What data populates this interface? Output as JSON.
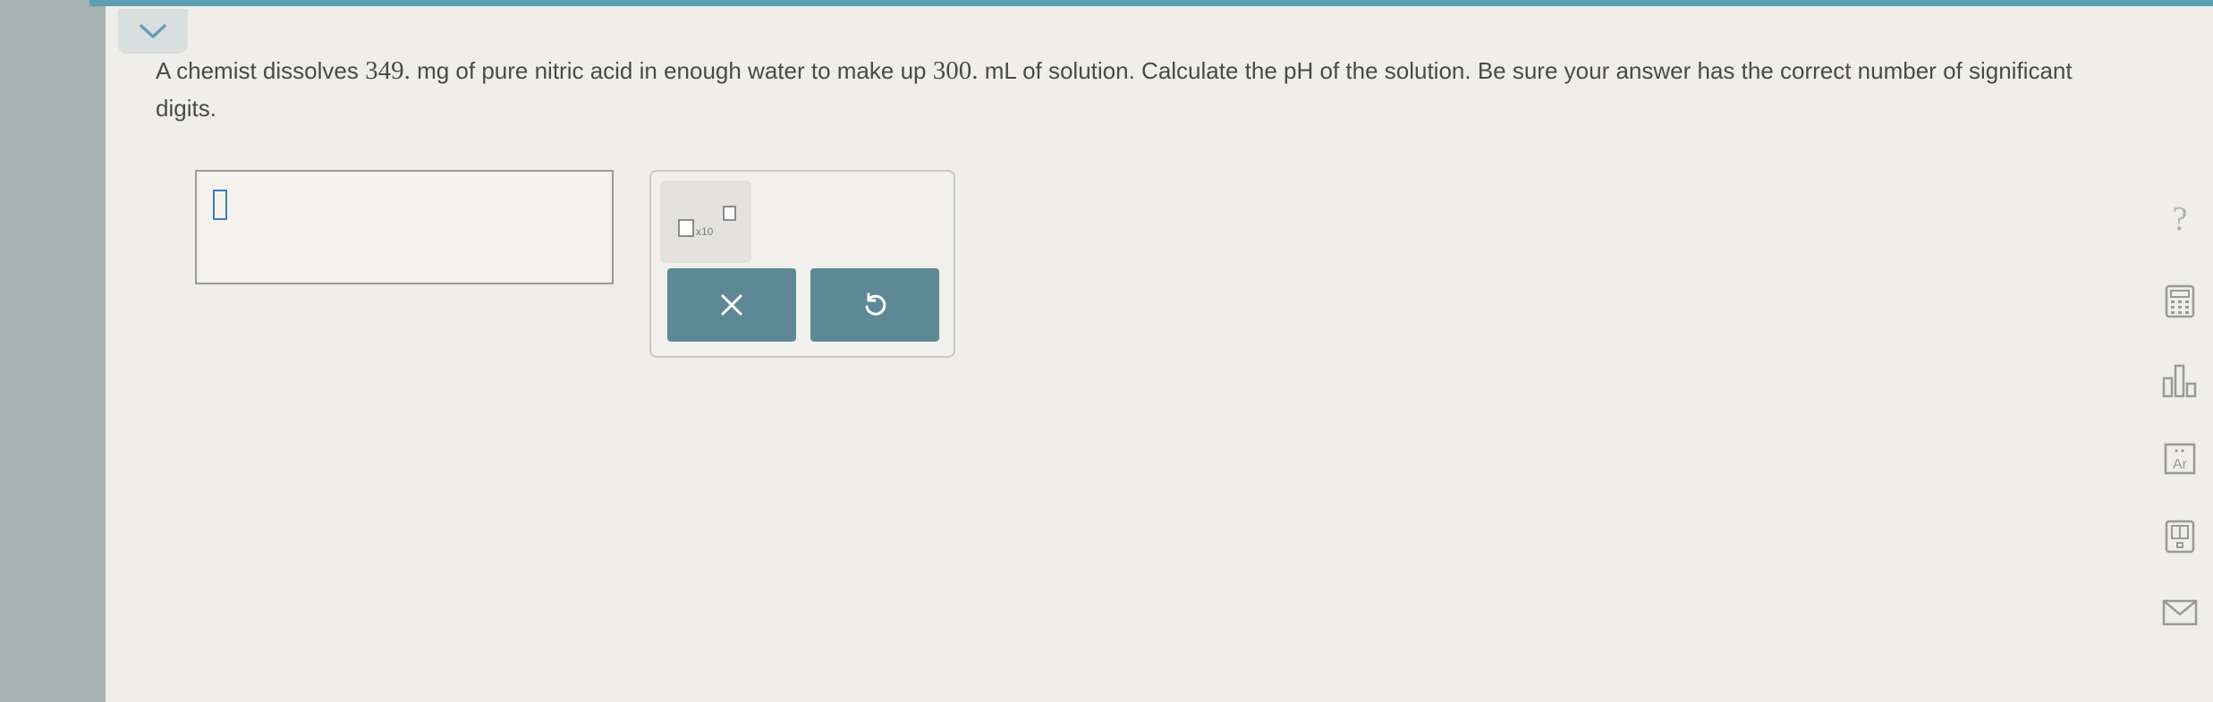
{
  "question": {
    "part1": "A chemist dissolves ",
    "mass": "349.",
    "part2": " mg of pure nitric acid in enough water to make up ",
    "volume": "300.",
    "part3": " mL of solution. Calculate the pH of the solution. Be sure your answer has the correct number of significant digits."
  },
  "answer": {
    "value": ""
  },
  "toolbox": {
    "sci_notation_label": "x10",
    "buttons": [
      "clear-icon",
      "undo-icon"
    ]
  },
  "side_tools": {
    "help_label": "?",
    "items": [
      "help-icon",
      "calculator-icon",
      "chart-icon",
      "periodic-table-icon",
      "reference-icon",
      "mail-icon"
    ]
  },
  "colors": {
    "accent_bar": "#5f9fb6",
    "action_buttons": "#5f8897",
    "cursor": "#3d7db1",
    "text": "#4a4a4a"
  }
}
